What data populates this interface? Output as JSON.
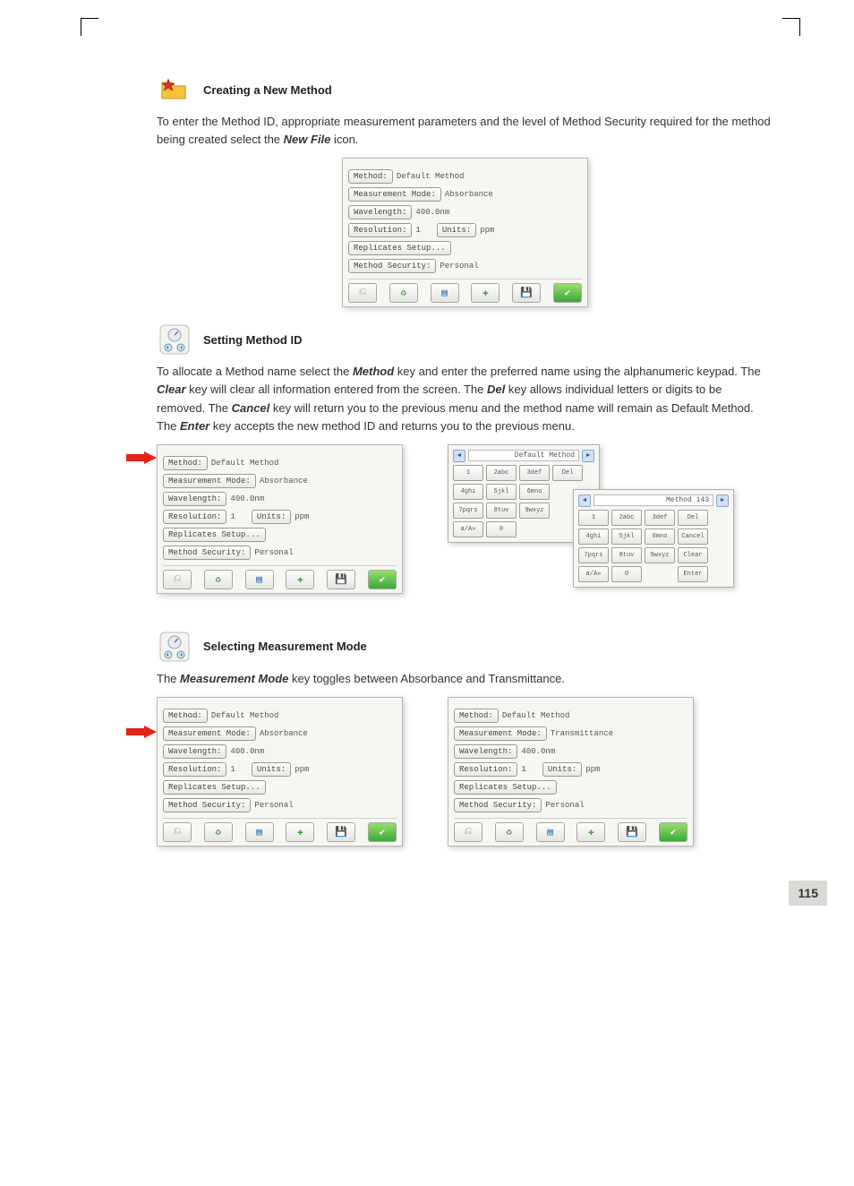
{
  "page_number": "115",
  "section1": {
    "title": "Creating a New Method",
    "para_segments": [
      {
        "t": "To enter the Method ID, appropriate measurement parameters and the level of Method Security required for the method being created select the ",
        "b": false
      },
      {
        "t": "New File",
        "b": true
      },
      {
        "t": " icon.",
        "b": false
      }
    ]
  },
  "section2": {
    "title": "Setting Method ID",
    "para_segments": [
      {
        "t": "To allocate a Method name select the ",
        "b": false
      },
      {
        "t": "Method",
        "b": true
      },
      {
        "t": " key and enter the preferred name using the alphanumeric keypad. The ",
        "b": false
      },
      {
        "t": "Clear",
        "b": true
      },
      {
        "t": " key will clear all information entered from the screen. The ",
        "b": false
      },
      {
        "t": "Del",
        "b": true
      },
      {
        "t": " key allows individual letters or digits to be removed. The ",
        "b": false
      },
      {
        "t": "Cancel",
        "b": true
      },
      {
        "t": " key will return you to the previous menu and the method name will remain as Default Method. The ",
        "b": false
      },
      {
        "t": "Enter",
        "b": true
      },
      {
        "t": " key accepts the new method ID and returns you to the previous menu.",
        "b": false
      }
    ]
  },
  "section3": {
    "title": "Selecting Measurement Mode",
    "para_segments": [
      {
        "t": "The ",
        "b": false
      },
      {
        "t": "Measurement Mode",
        "b": true
      },
      {
        "t": " key toggles between Absorbance and Transmittance.",
        "b": false
      }
    ]
  },
  "form": {
    "method_btn": "Method:",
    "method_val": "Default Method",
    "measmode_btn": "Measurement Mode:",
    "measmode_abs": "Absorbance",
    "measmode_trans": "Transmittance",
    "wavelength_btn": "Wavelength:",
    "wavelength_val": "400.0nm",
    "resolution_btn": "Resolution:",
    "resolution_val": "1",
    "units_btn": "Units:",
    "units_val": "ppm",
    "replicates_btn": "Replicates Setup...",
    "security_btn": "Method Security:",
    "security_val": "Personal"
  },
  "keypad1": {
    "title": "Default Method",
    "keys": [
      "1",
      "2abc",
      "3def",
      "Del",
      "4ghi",
      "5jkl",
      "6mno",
      "",
      "7pqrs",
      "8tuv",
      "9wxyz",
      "",
      "a/A»",
      "0",
      "",
      ""
    ]
  },
  "keypad2": {
    "title": "Method 143",
    "keys": [
      "1",
      "2abc",
      "3def",
      "Del",
      "4ghi",
      "5jkl",
      "6mno",
      "Cancel",
      "7pqrs",
      "8tuv",
      "9wxyz",
      "Clear",
      "a/A»",
      "0",
      "",
      "Enter"
    ]
  }
}
